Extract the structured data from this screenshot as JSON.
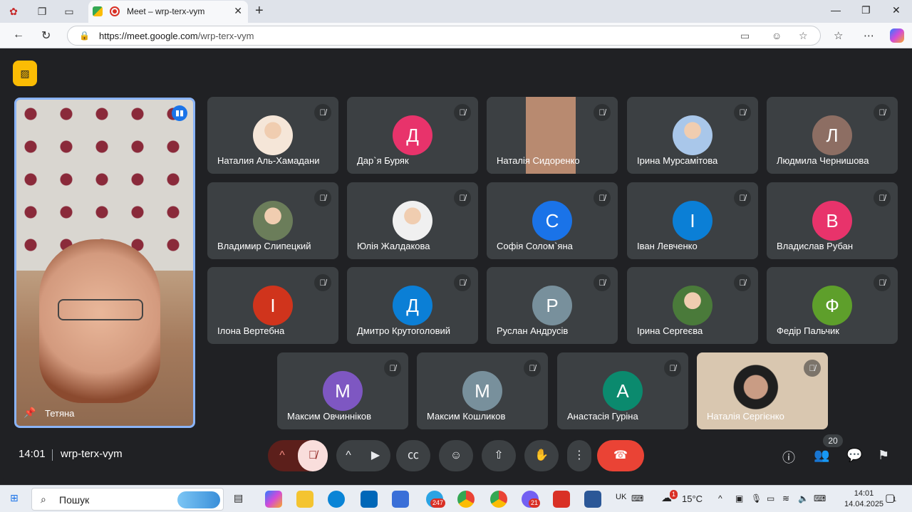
{
  "browser": {
    "tab_title": "Meet – wrp-terx-vym",
    "url_host": "https://meet.google.com",
    "url_path": "/wrp-terx-vym"
  },
  "meeting": {
    "time": "14:01",
    "code": "wrp-terx-vym",
    "people_count": "20",
    "self": {
      "name": "Тетяна"
    }
  },
  "participants": [
    {
      "name": "Наталия Аль-Хамадани",
      "initial": "",
      "color": "#f5e6d8"
    },
    {
      "name": "Дар`я Буряк",
      "initial": "Д",
      "color": "#e8336b"
    },
    {
      "name": "Наталія Сидоренко",
      "initial": "",
      "color": ""
    },
    {
      "name": "Ірина Мурсамітова",
      "initial": "",
      "color": "#a9c7ea"
    },
    {
      "name": "Людмила Чернишова",
      "initial": "Л",
      "color": "#8d6e63"
    },
    {
      "name": "Владимир Слипецкий",
      "initial": "",
      "color": "#6b7d5a"
    },
    {
      "name": "Юлія Жалдакова",
      "initial": "",
      "color": "#f0f0f0"
    },
    {
      "name": "Софія Солом`яна",
      "initial": "С",
      "color": "#1a73e8"
    },
    {
      "name": "Іван Левченко",
      "initial": "І",
      "color": "#0b7fd6"
    },
    {
      "name": "Владислав Рубан",
      "initial": "В",
      "color": "#e8336b"
    },
    {
      "name": "Ілона Вертебна",
      "initial": "І",
      "color": "#d0341c"
    },
    {
      "name": "Дмитро Крутоголовий",
      "initial": "Д",
      "color": "#0b7fd6"
    },
    {
      "name": "Руслан Андрусів",
      "initial": "Р",
      "color": "#78909c"
    },
    {
      "name": "Ірина Сергеєва",
      "initial": "",
      "color": "#4a7a3a"
    },
    {
      "name": "Федір Пальчик",
      "initial": "Ф",
      "color": "#5e9f2b"
    },
    {
      "name": "Максим Овчинніков",
      "initial": "М",
      "color": "#7e57c2"
    },
    {
      "name": "Максим Кошликов",
      "initial": "М",
      "color": "#78909c"
    },
    {
      "name": "Анастасія Гуріна",
      "initial": "А",
      "color": "#0b8a6e"
    },
    {
      "name": "Наталія Сергієнко",
      "initial": "",
      "color": ""
    }
  ],
  "taskbar": {
    "search_label": "Пошук",
    "weather": "15°C",
    "lang": "UK",
    "time": "14:01",
    "date": "14.04.2025",
    "telegram_badge": "247",
    "viber_badge": "21",
    "notif_badge": "1",
    "weather_badge": "1"
  },
  "colors": {
    "accent": "#8ab4f8",
    "hangup": "#ea4335",
    "mic_off": "#f28b82",
    "no_camera_badge": "#fbbc04"
  }
}
